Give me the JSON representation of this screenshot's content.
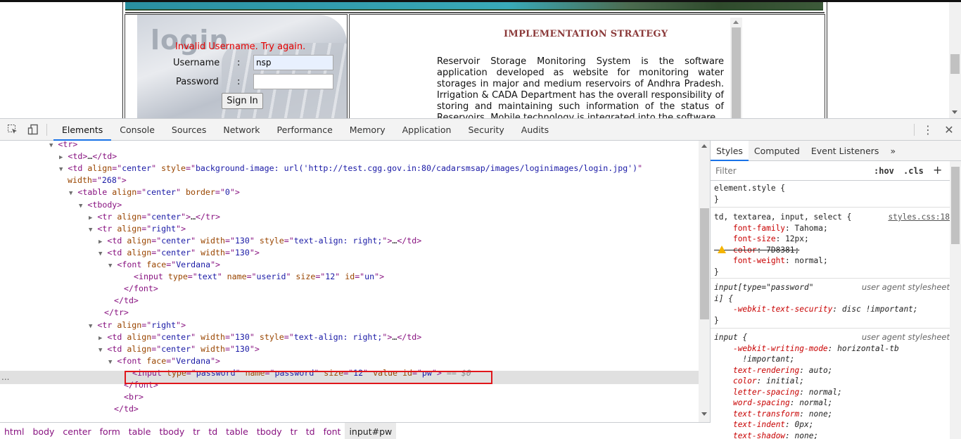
{
  "page": {
    "login_word": "login",
    "error_message": "Invalid Username. Try again.",
    "username_label": "Username",
    "password_label": "Password",
    "colon": ":",
    "username_value": "nsp",
    "password_value": "",
    "signin_label": "Sign In",
    "strategy_title": "IMPLEMENTATION STRATEGY",
    "strategy_text": "Reservoir Storage Monitoring System is the software application developed as website for monitoring water storages in major and medium reservoirs of Andhra Pradesh. Irrigation & CADA Department has the overall responsibility of storing and maintaining such information of the status of Reservoirs. Mobile technology is integrated into the software"
  },
  "devtools": {
    "tabs": [
      "Elements",
      "Console",
      "Sources",
      "Network",
      "Performance",
      "Memory",
      "Application",
      "Security",
      "Audits"
    ],
    "active_tab": "Elements",
    "inspect_icon": "inspect-icon",
    "device_icon": "device-toolbar-icon",
    "menu_icon": "kebab-menu-icon",
    "close_icon": "close-icon",
    "dom_lines": [
      {
        "indent": 84,
        "tri": "▼",
        "html": "<span class='t-tag'>&lt;tr&gt;</span>"
      },
      {
        "indent": 98,
        "tri": "▶",
        "html": "<span class='t-tag'>&lt;td&gt;</span><span class='t-txt'>…</span><span class='t-tag'>&lt;/td&gt;</span>"
      },
      {
        "indent": 98,
        "tri": "▼",
        "html": "<span class='t-tag'>&lt;td </span><span class='t-attr'>align</span><span class='t-tag'>=\"</span><span class='t-val'>center</span><span class='t-tag'>\" </span><span class='t-attr'>style</span><span class='t-tag'>=\"</span><span class='t-val'>background-image: url('http://test.cgg.gov.in:80/cadarsmsap/images/loginimages/login.jpg')</span><span class='t-tag'>\"</span>"
      },
      {
        "indent": 96,
        "tri": "",
        "html": "<span class='t-attr'>width</span><span class='t-tag'>=\"</span><span class='t-val'>268</span><span class='t-tag'>\"&gt;</span>"
      },
      {
        "indent": 112,
        "tri": "▼",
        "html": "<span class='t-tag'>&lt;table </span><span class='t-attr'>align</span><span class='t-tag'>=\"</span><span class='t-val'>center</span><span class='t-tag'>\" </span><span class='t-attr'>border</span><span class='t-tag'>=\"</span><span class='t-val'>0</span><span class='t-tag'>\"&gt;</span>"
      },
      {
        "indent": 126,
        "tri": "▼",
        "html": "<span class='t-tag'>&lt;tbody&gt;</span>"
      },
      {
        "indent": 140,
        "tri": "▶",
        "html": "<span class='t-tag'>&lt;tr </span><span class='t-attr'>align</span><span class='t-tag'>=\"</span><span class='t-val'>center</span><span class='t-tag'>\"&gt;</span><span class='t-txt'>…</span><span class='t-tag'>&lt;/tr&gt;</span>"
      },
      {
        "indent": 140,
        "tri": "▼",
        "html": "<span class='t-tag'>&lt;tr </span><span class='t-attr'>align</span><span class='t-tag'>=\"</span><span class='t-val'>right</span><span class='t-tag'>\"&gt;</span>"
      },
      {
        "indent": 154,
        "tri": "▶",
        "html": "<span class='t-tag'>&lt;td </span><span class='t-attr'>align</span><span class='t-tag'>=\"</span><span class='t-val'>center</span><span class='t-tag'>\" </span><span class='t-attr'>width</span><span class='t-tag'>=\"</span><span class='t-val'>130</span><span class='t-tag'>\" </span><span class='t-attr'>style</span><span class='t-tag'>=\"</span><span class='t-val'>text-align: right;</span><span class='t-tag'>\"&gt;</span><span class='t-txt'>…</span><span class='t-tag'>&lt;/td&gt;</span>"
      },
      {
        "indent": 154,
        "tri": "▼",
        "html": "<span class='t-tag'>&lt;td </span><span class='t-attr'>align</span><span class='t-tag'>=\"</span><span class='t-val'>center</span><span class='t-tag'>\" </span><span class='t-attr'>width</span><span class='t-tag'>=\"</span><span class='t-val'>130</span><span class='t-tag'>\"&gt;</span>"
      },
      {
        "indent": 168,
        "tri": "▼",
        "html": "<span class='t-tag'>&lt;font </span><span class='t-attr'>face</span><span class='t-tag'>=\"</span><span class='t-val'>Verdana</span><span class='t-tag'>\"&gt;</span>"
      },
      {
        "indent": 190,
        "tri": "",
        "html": "<span class='t-tag'>&lt;input </span><span class='t-attr'>type</span><span class='t-tag'>=\"</span><span class='t-val'>text</span><span class='t-tag'>\" </span><span class='t-attr'>name</span><span class='t-tag'>=\"</span><span class='t-val'>userid</span><span class='t-tag'>\" </span><span class='t-attr'>size</span><span class='t-tag'>=\"</span><span class='t-val'>12</span><span class='t-tag'>\" </span><span class='t-attr'>id</span><span class='t-tag'>=\"</span><span class='t-val'>un</span><span class='t-tag'>\"&gt;</span>"
      },
      {
        "indent": 176,
        "tri": "",
        "html": "<span class='t-tag'>&lt;/font&gt;</span>"
      },
      {
        "indent": 162,
        "tri": "",
        "html": "<span class='t-tag'>&lt;/td&gt;</span>"
      },
      {
        "indent": 148,
        "tri": "",
        "html": "<span class='t-tag'>&lt;/tr&gt;</span>"
      },
      {
        "indent": 140,
        "tri": "▼",
        "html": "<span class='t-tag'>&lt;tr </span><span class='t-attr'>align</span><span class='t-tag'>=\"</span><span class='t-val'>right</span><span class='t-tag'>\"&gt;</span>"
      },
      {
        "indent": 154,
        "tri": "▶",
        "html": "<span class='t-tag'>&lt;td </span><span class='t-attr'>align</span><span class='t-tag'>=\"</span><span class='t-val'>center</span><span class='t-tag'>\" </span><span class='t-attr'>width</span><span class='t-tag'>=\"</span><span class='t-val'>130</span><span class='t-tag'>\" </span><span class='t-attr'>style</span><span class='t-tag'>=\"</span><span class='t-val'>text-align: right;</span><span class='t-tag'>\"&gt;</span><span class='t-txt'>…</span><span class='t-tag'>&lt;/td&gt;</span>"
      },
      {
        "indent": 154,
        "tri": "▼",
        "html": "<span class='t-tag'>&lt;td </span><span class='t-attr'>align</span><span class='t-tag'>=\"</span><span class='t-val'>center</span><span class='t-tag'>\" </span><span class='t-attr'>width</span><span class='t-tag'>=\"</span><span class='t-val'>130</span><span class='t-tag'>\"&gt;</span>"
      },
      {
        "indent": 168,
        "tri": "▼",
        "html": "<span class='t-tag'>&lt;font </span><span class='t-attr'>face</span><span class='t-tag'>=\"</span><span class='t-val'>Verdana</span><span class='t-tag'>\"&gt;</span>"
      },
      {
        "indent": 188,
        "tri": "",
        "html": "<span class='t-tag'>&lt;input </span><span class='t-attr'>type</span><span class='t-tag'>=\"</span><span class='t-val'>password</span><span class='t-tag'>\" </span><span class='t-attr'>name</span><span class='t-tag'>=\"</span><span class='t-val'>password</span><span class='t-tag'>\" </span><span class='t-attr'>size</span><span class='t-tag'>=\"</span><span class='t-val'>12</span><span class='t-tag'>\" </span><span class='t-attr'>value id</span><span class='t-tag'>=\"</span><span class='t-val'>pw</span><span class='t-tag'>\"&gt;</span><span class='t-eq'> == $0</span>",
        "selected": true
      },
      {
        "indent": 176,
        "tri": "",
        "html": "<span class='t-tag'>&lt;/font&gt;</span>"
      },
      {
        "indent": 176,
        "tri": "",
        "html": "<span class='t-tag'>&lt;br&gt;</span>"
      },
      {
        "indent": 162,
        "tri": "",
        "html": "<span class='t-tag'>&lt;/td&gt;</span>"
      }
    ],
    "selected_marker": "...",
    "breadcrumbs": [
      "html",
      "body",
      "center",
      "form",
      "table",
      "tbody",
      "tr",
      "td",
      "table",
      "tbody",
      "tr",
      "td",
      "font",
      "input#pw"
    ],
    "styles_tabs": [
      "Styles",
      "Computed",
      "Event Listeners",
      "»"
    ],
    "filter_placeholder": "Filter",
    "hov_label": ":hov",
    "cls_label": ".cls",
    "plus_label": "+",
    "element_style_selector": "element.style {",
    "close_brace": "}",
    "rule1_selector": "td, textarea, input, select {",
    "rule1_source": "styles.css:18",
    "rule1_props": [
      {
        "name": "font-family",
        "value": "Tahoma;"
      },
      {
        "name": "font-size",
        "value": "12px;"
      },
      {
        "name": "color",
        "value": "7D8381;",
        "struck": true
      },
      {
        "name": "font-weight",
        "value": "normal;"
      }
    ],
    "ua_label": "user agent stylesheet",
    "rule2_selector": "input[type=\"password\"",
    "rule2_selector_cont": "i] {",
    "rule2_props": [
      {
        "name": "-webkit-text-security",
        "value": "disc !important;"
      }
    ],
    "rule3_selector": "input {",
    "rule3_props": [
      {
        "name": "-webkit-writing-mode",
        "value": "horizontal-tb"
      },
      {
        "name": "",
        "value": "!important;"
      },
      {
        "name": "text-rendering",
        "value": "auto;"
      },
      {
        "name": "color",
        "value": "initial;"
      },
      {
        "name": "letter-spacing",
        "value": "normal;"
      },
      {
        "name": "word-spacing",
        "value": "normal;"
      },
      {
        "name": "text-transform",
        "value": "none;"
      },
      {
        "name": "text-indent",
        "value": "0px;"
      },
      {
        "name": "text-shadow",
        "value": "none;"
      }
    ]
  }
}
